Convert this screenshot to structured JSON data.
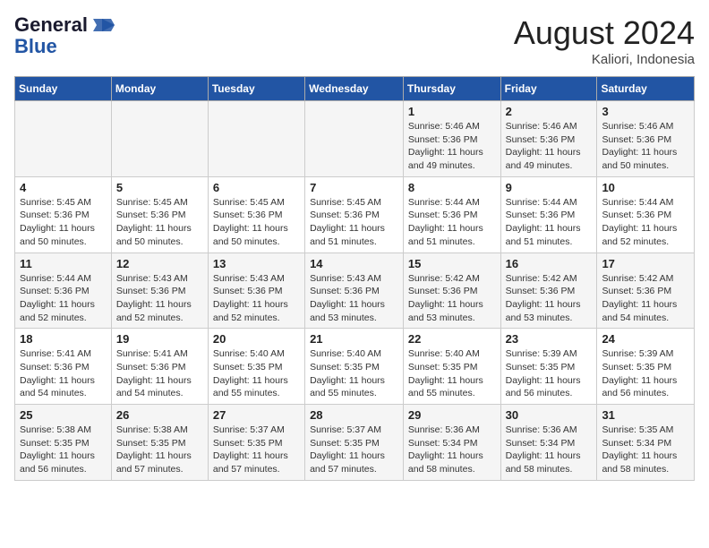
{
  "logo": {
    "line1": "General",
    "line2": "Blue"
  },
  "title": "August 2024",
  "subtitle": "Kaliori, Indonesia",
  "days_of_week": [
    "Sunday",
    "Monday",
    "Tuesday",
    "Wednesday",
    "Thursday",
    "Friday",
    "Saturday"
  ],
  "weeks": [
    [
      {
        "day": "",
        "sunrise": "",
        "sunset": "",
        "daylight": ""
      },
      {
        "day": "",
        "sunrise": "",
        "sunset": "",
        "daylight": ""
      },
      {
        "day": "",
        "sunrise": "",
        "sunset": "",
        "daylight": ""
      },
      {
        "day": "",
        "sunrise": "",
        "sunset": "",
        "daylight": ""
      },
      {
        "day": "1",
        "sunrise": "Sunrise: 5:46 AM",
        "sunset": "Sunset: 5:36 PM",
        "daylight": "Daylight: 11 hours and 49 minutes."
      },
      {
        "day": "2",
        "sunrise": "Sunrise: 5:46 AM",
        "sunset": "Sunset: 5:36 PM",
        "daylight": "Daylight: 11 hours and 49 minutes."
      },
      {
        "day": "3",
        "sunrise": "Sunrise: 5:46 AM",
        "sunset": "Sunset: 5:36 PM",
        "daylight": "Daylight: 11 hours and 50 minutes."
      }
    ],
    [
      {
        "day": "4",
        "sunrise": "Sunrise: 5:45 AM",
        "sunset": "Sunset: 5:36 PM",
        "daylight": "Daylight: 11 hours and 50 minutes."
      },
      {
        "day": "5",
        "sunrise": "Sunrise: 5:45 AM",
        "sunset": "Sunset: 5:36 PM",
        "daylight": "Daylight: 11 hours and 50 minutes."
      },
      {
        "day": "6",
        "sunrise": "Sunrise: 5:45 AM",
        "sunset": "Sunset: 5:36 PM",
        "daylight": "Daylight: 11 hours and 50 minutes."
      },
      {
        "day": "7",
        "sunrise": "Sunrise: 5:45 AM",
        "sunset": "Sunset: 5:36 PM",
        "daylight": "Daylight: 11 hours and 51 minutes."
      },
      {
        "day": "8",
        "sunrise": "Sunrise: 5:44 AM",
        "sunset": "Sunset: 5:36 PM",
        "daylight": "Daylight: 11 hours and 51 minutes."
      },
      {
        "day": "9",
        "sunrise": "Sunrise: 5:44 AM",
        "sunset": "Sunset: 5:36 PM",
        "daylight": "Daylight: 11 hours and 51 minutes."
      },
      {
        "day": "10",
        "sunrise": "Sunrise: 5:44 AM",
        "sunset": "Sunset: 5:36 PM",
        "daylight": "Daylight: 11 hours and 52 minutes."
      }
    ],
    [
      {
        "day": "11",
        "sunrise": "Sunrise: 5:44 AM",
        "sunset": "Sunset: 5:36 PM",
        "daylight": "Daylight: 11 hours and 52 minutes."
      },
      {
        "day": "12",
        "sunrise": "Sunrise: 5:43 AM",
        "sunset": "Sunset: 5:36 PM",
        "daylight": "Daylight: 11 hours and 52 minutes."
      },
      {
        "day": "13",
        "sunrise": "Sunrise: 5:43 AM",
        "sunset": "Sunset: 5:36 PM",
        "daylight": "Daylight: 11 hours and 52 minutes."
      },
      {
        "day": "14",
        "sunrise": "Sunrise: 5:43 AM",
        "sunset": "Sunset: 5:36 PM",
        "daylight": "Daylight: 11 hours and 53 minutes."
      },
      {
        "day": "15",
        "sunrise": "Sunrise: 5:42 AM",
        "sunset": "Sunset: 5:36 PM",
        "daylight": "Daylight: 11 hours and 53 minutes."
      },
      {
        "day": "16",
        "sunrise": "Sunrise: 5:42 AM",
        "sunset": "Sunset: 5:36 PM",
        "daylight": "Daylight: 11 hours and 53 minutes."
      },
      {
        "day": "17",
        "sunrise": "Sunrise: 5:42 AM",
        "sunset": "Sunset: 5:36 PM",
        "daylight": "Daylight: 11 hours and 54 minutes."
      }
    ],
    [
      {
        "day": "18",
        "sunrise": "Sunrise: 5:41 AM",
        "sunset": "Sunset: 5:36 PM",
        "daylight": "Daylight: 11 hours and 54 minutes."
      },
      {
        "day": "19",
        "sunrise": "Sunrise: 5:41 AM",
        "sunset": "Sunset: 5:36 PM",
        "daylight": "Daylight: 11 hours and 54 minutes."
      },
      {
        "day": "20",
        "sunrise": "Sunrise: 5:40 AM",
        "sunset": "Sunset: 5:35 PM",
        "daylight": "Daylight: 11 hours and 55 minutes."
      },
      {
        "day": "21",
        "sunrise": "Sunrise: 5:40 AM",
        "sunset": "Sunset: 5:35 PM",
        "daylight": "Daylight: 11 hours and 55 minutes."
      },
      {
        "day": "22",
        "sunrise": "Sunrise: 5:40 AM",
        "sunset": "Sunset: 5:35 PM",
        "daylight": "Daylight: 11 hours and 55 minutes."
      },
      {
        "day": "23",
        "sunrise": "Sunrise: 5:39 AM",
        "sunset": "Sunset: 5:35 PM",
        "daylight": "Daylight: 11 hours and 56 minutes."
      },
      {
        "day": "24",
        "sunrise": "Sunrise: 5:39 AM",
        "sunset": "Sunset: 5:35 PM",
        "daylight": "Daylight: 11 hours and 56 minutes."
      }
    ],
    [
      {
        "day": "25",
        "sunrise": "Sunrise: 5:38 AM",
        "sunset": "Sunset: 5:35 PM",
        "daylight": "Daylight: 11 hours and 56 minutes."
      },
      {
        "day": "26",
        "sunrise": "Sunrise: 5:38 AM",
        "sunset": "Sunset: 5:35 PM",
        "daylight": "Daylight: 11 hours and 57 minutes."
      },
      {
        "day": "27",
        "sunrise": "Sunrise: 5:37 AM",
        "sunset": "Sunset: 5:35 PM",
        "daylight": "Daylight: 11 hours and 57 minutes."
      },
      {
        "day": "28",
        "sunrise": "Sunrise: 5:37 AM",
        "sunset": "Sunset: 5:35 PM",
        "daylight": "Daylight: 11 hours and 57 minutes."
      },
      {
        "day": "29",
        "sunrise": "Sunrise: 5:36 AM",
        "sunset": "Sunset: 5:34 PM",
        "daylight": "Daylight: 11 hours and 58 minutes."
      },
      {
        "day": "30",
        "sunrise": "Sunrise: 5:36 AM",
        "sunset": "Sunset: 5:34 PM",
        "daylight": "Daylight: 11 hours and 58 minutes."
      },
      {
        "day": "31",
        "sunrise": "Sunrise: 5:35 AM",
        "sunset": "Sunset: 5:34 PM",
        "daylight": "Daylight: 11 hours and 58 minutes."
      }
    ]
  ]
}
